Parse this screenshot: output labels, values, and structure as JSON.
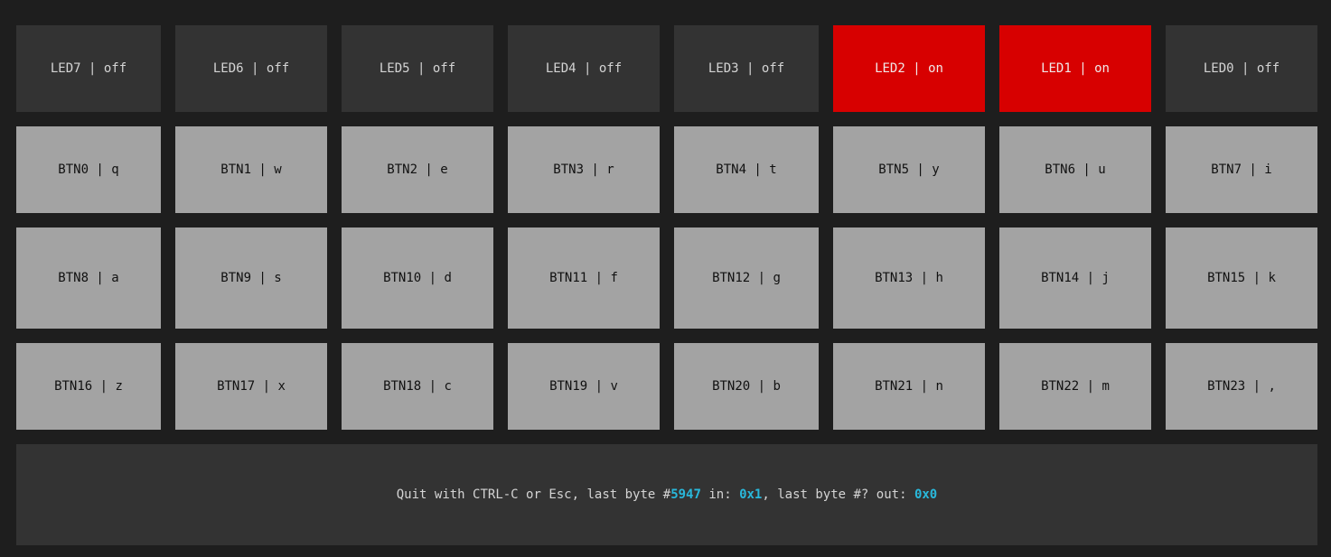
{
  "colors": {
    "background": "#1e1e1e",
    "led_off": "#333333",
    "led_on": "#d70000",
    "button": "#a3a3a3",
    "highlight": "#29b8db"
  },
  "leds": [
    {
      "label": "LED7 | off",
      "state": "off"
    },
    {
      "label": "LED6 | off",
      "state": "off"
    },
    {
      "label": "LED5 | off",
      "state": "off"
    },
    {
      "label": "LED4 | off",
      "state": "off"
    },
    {
      "label": "LED3 | off",
      "state": "off"
    },
    {
      "label": "LED2 | on",
      "state": "on"
    },
    {
      "label": "LED1 | on",
      "state": "on"
    },
    {
      "label": "LED0 | off",
      "state": "off"
    }
  ],
  "buttons": [
    "BTN0 | q",
    "BTN1 | w",
    "BTN2 | e",
    "BTN3 | r",
    "BTN4 | t",
    "BTN5 | y",
    "BTN6 | u",
    "BTN7 | i",
    "BTN8 | a",
    "BTN9 | s",
    "BTN10 | d",
    "BTN11 | f",
    "BTN12 | g",
    "BTN13 | h",
    "BTN14 | j",
    "BTN15 | k",
    "BTN16 | z",
    "BTN17 | x",
    "BTN18 | c",
    "BTN19 | v",
    "BTN20 | b",
    "BTN21 | n",
    "BTN22 | m",
    "BTN23 | ,"
  ],
  "status": {
    "prefix": "Quit with CTRL-C or Esc, last byte #",
    "in_count": "5947",
    "in_label": " in: ",
    "in_value": "0x1",
    "mid": ", last byte #? out: ",
    "out_value": "0x0"
  }
}
